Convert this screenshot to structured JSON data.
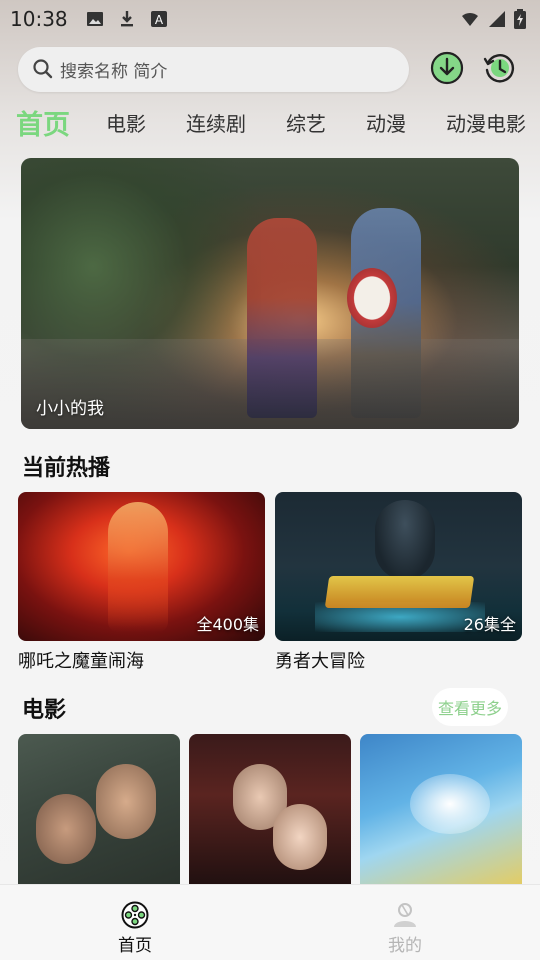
{
  "status_bar": {
    "time": "10:38",
    "left_icons": [
      "image-icon",
      "download-icon",
      "text-a-icon"
    ],
    "right_icons": [
      "wifi-icon",
      "signal-icon",
      "battery-icon"
    ]
  },
  "search": {
    "placeholder": "搜索名称 简介",
    "icon": "search-icon"
  },
  "top_buttons": [
    "download-circle-icon",
    "history-clock-icon"
  ],
  "categories": {
    "active": "首页",
    "items": [
      "首页",
      "电影",
      "连续剧",
      "综艺",
      "动漫",
      "动漫电影"
    ]
  },
  "banner": {
    "caption": "小小的我"
  },
  "hot": {
    "section_title": "当前热播",
    "items": [
      {
        "title": "哪吒之魔童闹海",
        "badge": "全400集"
      },
      {
        "title": "勇者大冒险",
        "badge": "26集全"
      }
    ]
  },
  "movies": {
    "section_title": "电影",
    "more_label": "查看更多"
  },
  "bottom_nav": {
    "items": [
      {
        "label": "首页",
        "icon": "film-reel-icon",
        "active": true
      },
      {
        "label": "我的",
        "icon": "user-icon",
        "active": false
      }
    ]
  },
  "colors": {
    "accent": "#7bd77f",
    "more_text": "#8ed08d",
    "inactive_nav": "#b5b5b5"
  }
}
